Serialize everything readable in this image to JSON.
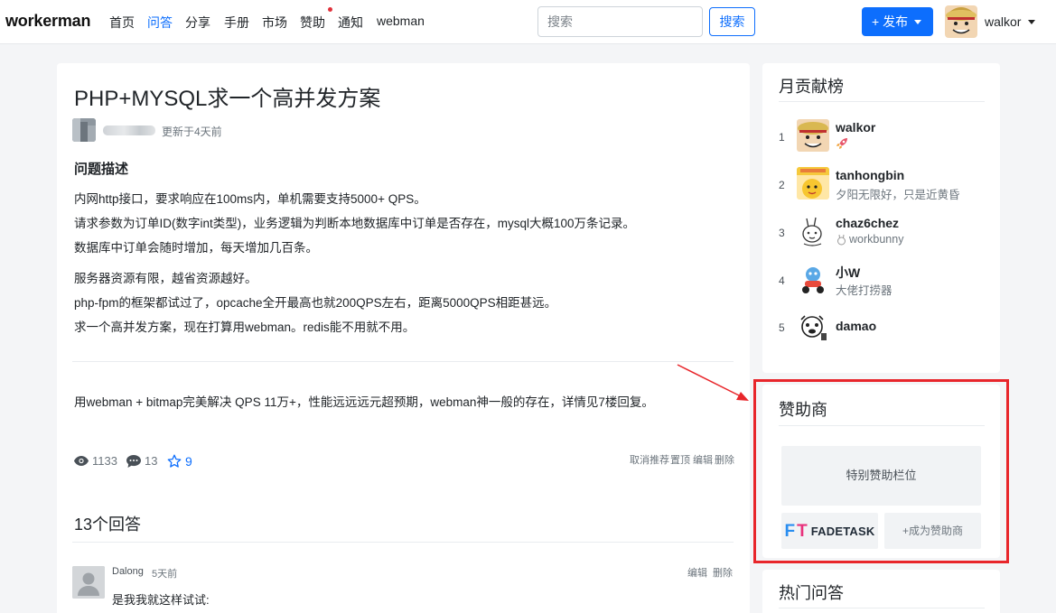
{
  "brand": "workerman",
  "nav": {
    "items": [
      "首页",
      "问答",
      "分享",
      "手册",
      "市场",
      "赞助",
      "通知",
      "webman"
    ],
    "active_index": 1,
    "search_placeholder": "搜索",
    "search_button": "搜索",
    "publish_button": "+ 发布",
    "user_name": "walkor"
  },
  "question": {
    "title": "PHP+MYSQL求一个高并发方案",
    "updated": "更新于4天前",
    "section_heading": "问题描述",
    "paragraphs": [
      "内网http接口，要求响应在100ms内，单机需要支持5000+ QPS。",
      "请求参数为订单ID(数字int类型)，业务逻辑为判断本地数据库中订单是否存在，mysql大概100万条记录。",
      "数据库中订单会随时增加，每天增加几百条。",
      "服务器资源有限，越省资源越好。",
      "php-fpm的框架都试过了，opcache全开最高也就200QPS左右，距离5000QPS相距甚远。",
      "求一个高并发方案，现在打算用webman。redis能不用就不用。"
    ],
    "note": "用webman + bitmap完美解决 QPS 11万+，性能远远远元超预期，webman神一般的存在，详情见7楼回复。",
    "views": "1133",
    "comments": "13",
    "stars": "9",
    "admin_links": [
      "取消推荐",
      "置顶",
      "编辑",
      "删除"
    ]
  },
  "answers": {
    "heading": "13个回答",
    "first": {
      "author": "Dalong",
      "time": "5天前",
      "text": "是我我就这样试试:",
      "links": [
        "编辑",
        "删除"
      ]
    }
  },
  "sidebar": {
    "monthly": {
      "title": "月贡献榜",
      "entries": [
        {
          "rank": "1",
          "name": "walkor",
          "sub": ""
        },
        {
          "rank": "2",
          "name": "tanhongbin",
          "sub": "夕阳无限好，只是近黄昏"
        },
        {
          "rank": "3",
          "name": "chaz6chez",
          "sub": "workbunny"
        },
        {
          "rank": "4",
          "name": "小W",
          "sub": "大佬打捞器"
        },
        {
          "rank": "5",
          "name": "damao",
          "sub": ""
        }
      ]
    },
    "sponsors": {
      "title": "赞助商",
      "special_slot": "特别赞助栏位",
      "logo_text": "FADETASK",
      "join": "+成为赞助商"
    },
    "hot": {
      "title": "热门问答"
    }
  },
  "colors": {
    "accent": "#0d6efd",
    "highlight_box": "#e8262b",
    "page_bg": "#f4f5f7"
  }
}
